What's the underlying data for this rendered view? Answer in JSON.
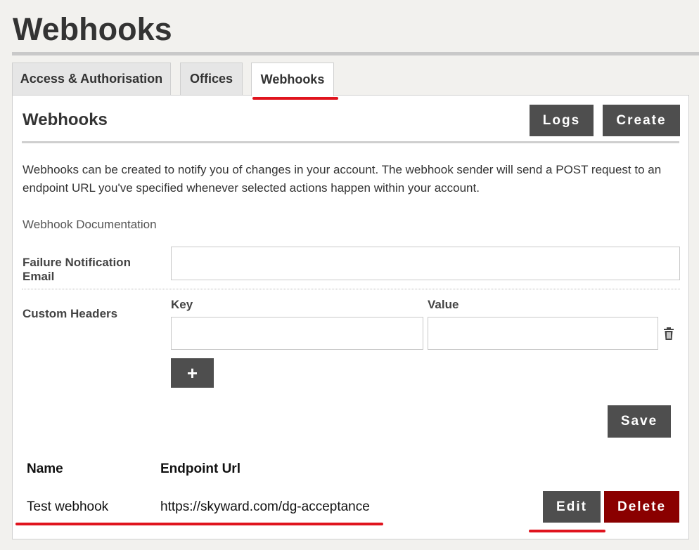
{
  "page": {
    "title": "Webhooks"
  },
  "tabs": [
    {
      "label": "Access & Authorisation",
      "active": false
    },
    {
      "label": "Offices",
      "active": false
    },
    {
      "label": "Webhooks",
      "active": true
    }
  ],
  "panel": {
    "title": "Webhooks",
    "logs_label": "Logs",
    "create_label": "Create",
    "description": "Webhooks can be created to notify you of changes in your account. The webhook sender will send a POST request to an endpoint URL you've specified whenever selected actions happen within your account.",
    "doc_link": "Webhook Documentation"
  },
  "form": {
    "failure_email": {
      "label_line1": "Failure Notification",
      "label_line2": "Email",
      "value": ""
    },
    "custom_headers": {
      "label": "Custom Headers",
      "key_label": "Key",
      "value_label": "Value",
      "rows": [
        {
          "key": "",
          "value": ""
        }
      ],
      "add_label": "+",
      "delete_icon": "trash-icon"
    },
    "save_label": "Save"
  },
  "table": {
    "columns": [
      "Name",
      "Endpoint Url"
    ],
    "rows": [
      {
        "name": "Test webhook",
        "endpoint_url": "https://skyward.com/dg-acceptance",
        "edit_label": "Edit",
        "delete_label": "Delete"
      }
    ]
  },
  "colors": {
    "button": "#4e4e4e",
    "danger": "#8a0000",
    "annotation": "#e0141e",
    "background": "#f2f1ee"
  }
}
